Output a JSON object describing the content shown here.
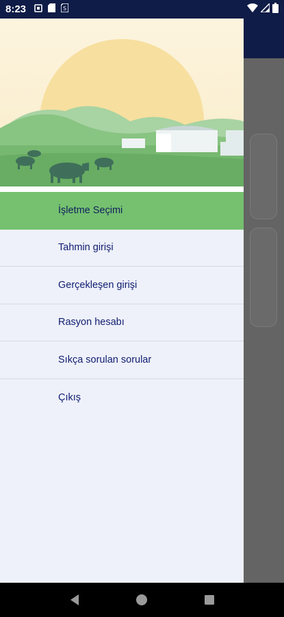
{
  "status_bar": {
    "time": "8:23",
    "left_icons": [
      "notification-icon",
      "sd-card-icon",
      "sim-icon"
    ],
    "right_icons": [
      "wifi-icon",
      "signal-icon",
      "battery-icon"
    ]
  },
  "drawer": {
    "header_image": "farm-illustration",
    "menu": {
      "items": [
        {
          "label": "İşletme Seçimi",
          "active": true
        },
        {
          "label": "Tahmin girişi",
          "active": false
        },
        {
          "label": "Gerçekleşen girişi",
          "active": false
        },
        {
          "label": "Rasyon hesabı",
          "active": false
        },
        {
          "label": "Sıkça sorulan sorular",
          "active": false
        },
        {
          "label": "Çıkış",
          "active": false
        }
      ]
    }
  },
  "nav_bar": {
    "buttons": [
      "back-icon",
      "home-icon",
      "recents-icon"
    ]
  },
  "colors": {
    "primary_dark": "#0f1c47",
    "active_item": "#75c16f",
    "drawer_bg": "#eef1fa",
    "menu_text": "#0f1c70"
  }
}
